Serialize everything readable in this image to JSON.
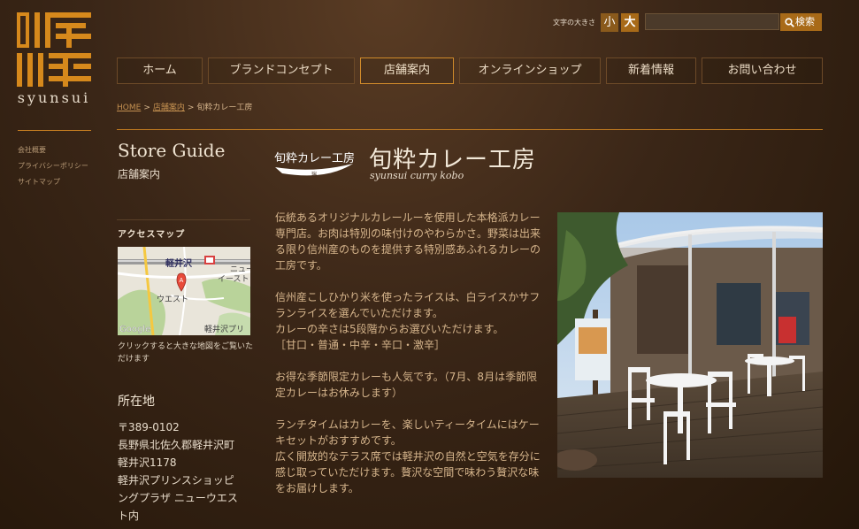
{
  "brand": {
    "logo_text": "syunsui"
  },
  "side_links": [
    "会社概要",
    "プライバシーポリシー",
    "サイトマップ"
  ],
  "font_size": {
    "label": "文字の大きさ",
    "small": "小",
    "big": "大"
  },
  "search": {
    "value": "",
    "placeholder": "",
    "button": "検索"
  },
  "nav": [
    {
      "label": "ホーム"
    },
    {
      "label": "ブランドコンセプト"
    },
    {
      "label": "店舗案内",
      "active": true
    },
    {
      "label": "オンラインショップ"
    },
    {
      "label": "新着情報"
    },
    {
      "label": "お問い合わせ"
    }
  ],
  "breadcrumb": {
    "home": "HOME",
    "sep": ">",
    "stores": "店舗案内",
    "current": "旬粋カレー工房"
  },
  "store_guide": {
    "title": "Store Guide",
    "subtitle": "店舗案内"
  },
  "access": {
    "title": "アクセスマップ",
    "map_labels": {
      "station": "軽井沢",
      "station_sub": "ニュー",
      "station_sub2": "イースト",
      "west": "ウエスト",
      "prince": "軽井沢プリ",
      "google": "Google",
      "marker": "A"
    },
    "caption": "クリックすると大きな地図をご覧いただけます"
  },
  "address": {
    "title": "所在地",
    "lines": [
      "〒389-0102",
      "長野県北佐久郡軽井沢町",
      "軽井沢1178",
      "軽井沢プリンスショッピ",
      "ングプラザ ニューウエス",
      "ト内"
    ]
  },
  "store": {
    "logo_text": "旬粋カレー工房",
    "logo_small": "瑞",
    "title": "旬粋カレー工房",
    "subtitle": "syunsui curry kobo"
  },
  "description": [
    "伝統あるオリジナルカレールーを使用した本格派カレー専門店。お肉は特別の味付けのやわらかさ。野菜は出来る限り信州産のものを提供する特別感あふれるカレーの工房です。",
    "信州産こしひかり米を使ったライスは、白ライスかサフランライスを選んでいただけます。\nカレーの辛さは5段階からお選びいただけます。\n［甘口・普通・中辛・辛口・激辛］",
    "お得な季節限定カレーも人気です。（7月、8月は季節限定カレーはお休みします）",
    "ランチタイムはカレーを、楽しいティータイムにはケーキセットがおすすめです。\n広く開放的なテラス席では軽井沢の自然と空気を存分に感じ取っていただけます。贅沢な空間で味わう贅沢な味をお届けします。"
  ],
  "colors": {
    "accent": "#c07a20",
    "text_highlight": "#d6b58c",
    "background": "#3a2617"
  }
}
